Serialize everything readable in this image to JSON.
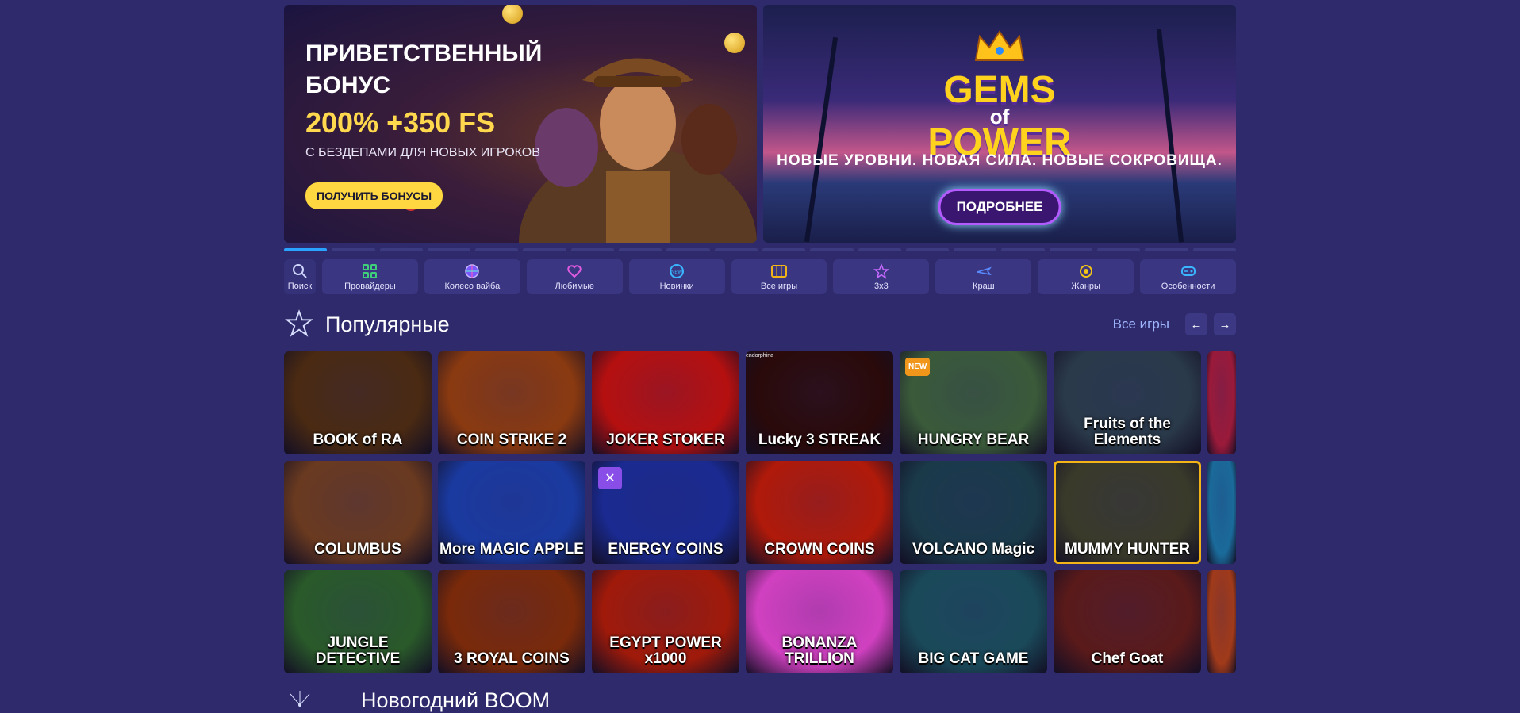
{
  "banners": {
    "welcome": {
      "title_line1": "ПРИВЕТСТВЕННЫЙ",
      "title_line2": "БОНУС",
      "highlight": "200% +350 FS",
      "subtitle": "С БЕЗДЕПАМИ ДЛЯ НОВЫХ ИГРОКОВ",
      "button": "ПОЛУЧИТЬ БОНУСЫ"
    },
    "gems": {
      "logo_line1": "GEMS",
      "logo_line2": "of",
      "logo_line3": "POWER",
      "tagline": "НОВЫЕ УРОВНИ. НОВАЯ СИЛА. НОВЫЕ СОКРОВИЩА.",
      "button": "ПОДРОБНЕЕ"
    },
    "slide_count": 20,
    "active_slide": 1
  },
  "nav": {
    "search": "Поиск",
    "items": [
      {
        "label": "Провайдеры",
        "icon": "grid-icon"
      },
      {
        "label": "Колесо вайба",
        "icon": "wheel-icon"
      },
      {
        "label": "Любимые",
        "icon": "heart-icon"
      },
      {
        "label": "Новинки",
        "icon": "new-icon"
      },
      {
        "label": "Все игры",
        "icon": "slots-icon"
      },
      {
        "label": "3x3",
        "icon": "star-icon"
      },
      {
        "label": "Краш",
        "icon": "plane-icon"
      },
      {
        "label": "Жанры",
        "icon": "genre-icon"
      },
      {
        "label": "Особенности",
        "icon": "gamepad-icon"
      }
    ]
  },
  "popular": {
    "title": "Популярные",
    "all_games": "Все игры",
    "prev": "←",
    "next": "→",
    "games": [
      {
        "name": "BOOK of RA",
        "bg": "#4a2a12"
      },
      {
        "name": "COIN STRIKE 2",
        "bg": "#8a3a10"
      },
      {
        "name": "JOKER STOKER",
        "bg": "#b51010"
      },
      {
        "name": "Lucky 3 STREAK",
        "bg": "#2a0a0a",
        "brand": "endorphina"
      },
      {
        "name": "HUNGRY BEAR",
        "bg": "#3a5a3a",
        "badge": "NEW"
      },
      {
        "name": "Fruits of the Elements",
        "bg": "#2a3a4a"
      },
      {
        "name": "",
        "bg": "#9a1a3a"
      },
      {
        "name": "COLUMBUS",
        "bg": "#6a3a20"
      },
      {
        "name": "More MAGIC APPLE",
        "bg": "#1a3aa0"
      },
      {
        "name": "ENERGY COINS",
        "bg": "#1a2a90",
        "sword": true
      },
      {
        "name": "CROWN COINS",
        "bg": "#b01a0a"
      },
      {
        "name": "VOLCANO Magic",
        "bg": "#1a3a4a"
      },
      {
        "name": "MUMMY HUNTER",
        "bg": "#3a3a2a",
        "selected": true
      },
      {
        "name": "",
        "bg": "#1a6a9a"
      },
      {
        "name": "JUNGLE DETECTIVE",
        "bg": "#2a5a2a"
      },
      {
        "name": "3 ROYAL COINS",
        "bg": "#7a2a0a"
      },
      {
        "name": "EGYPT POWER x1000",
        "bg": "#a01a0a"
      },
      {
        "name": "BONANZA TRILLION",
        "bg": "#d040c0"
      },
      {
        "name": "BIG CAT GAME",
        "bg": "#1a4a5a"
      },
      {
        "name": "Chef Goat",
        "bg": "#5a1a1a"
      },
      {
        "name": "",
        "bg": "#a03a1a"
      }
    ]
  },
  "next_section": {
    "title": "Новогодний BOOM"
  }
}
